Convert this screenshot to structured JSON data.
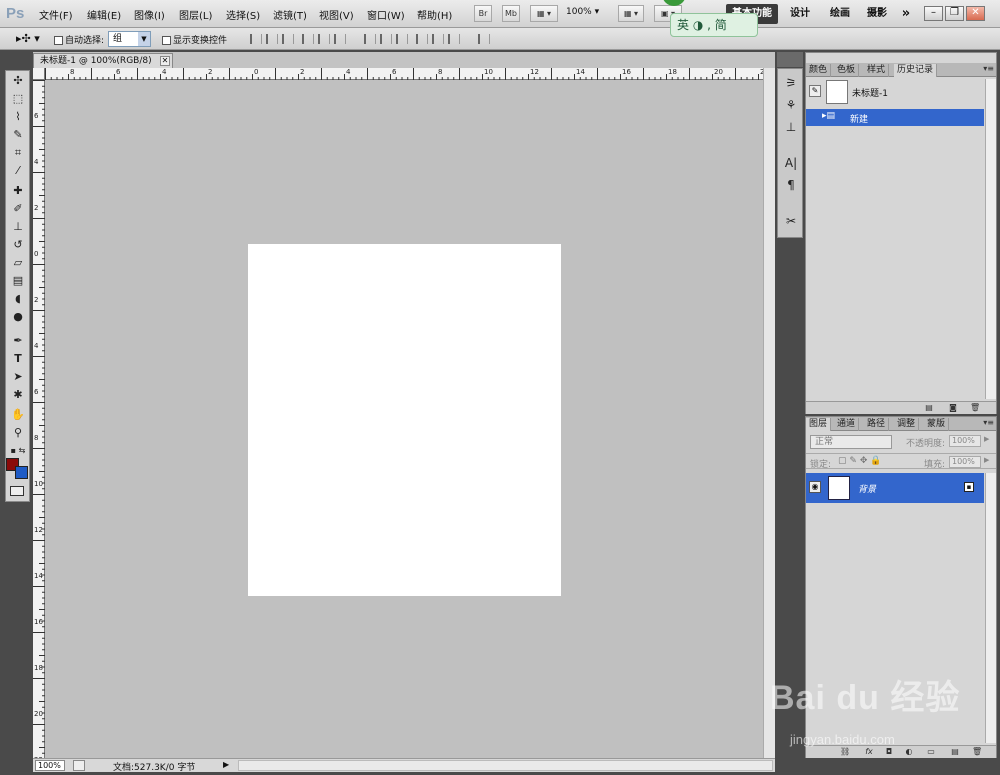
{
  "app": {
    "logo": "Ps"
  },
  "menubar": {
    "items": [
      "文件(F)",
      "编辑(E)",
      "图像(I)",
      "图层(L)",
      "选择(S)",
      "滤镜(T)",
      "视图(V)",
      "窗口(W)",
      "帮助(H)"
    ],
    "br_label": "Br",
    "mb_label": "Mb",
    "zoom_value": "100%",
    "workspaces": [
      "基本功能",
      "设计",
      "绘画",
      "摄影"
    ],
    "more": "»",
    "window_controls": [
      "–",
      "❐",
      "✕"
    ]
  },
  "ime": {
    "text": "英 ◑ , 简"
  },
  "options_bar": {
    "auto_select_label": "自动选择:",
    "auto_select_value": "组",
    "show_transform_label": "显示变换控件"
  },
  "document": {
    "tab_title": "未标题-1 @ 100%(RGB/8)",
    "tab_close": "✕",
    "ruler_h_labels": [
      "8",
      "6",
      "4",
      "2",
      "0",
      "2",
      "4",
      "6",
      "8",
      "10",
      "12",
      "14",
      "16",
      "18",
      "20",
      "22"
    ],
    "ruler_v_labels": [
      "6",
      "4",
      "2",
      "0",
      "2",
      "4",
      "6",
      "8",
      "10",
      "12",
      "14",
      "16",
      "18",
      "20",
      "22"
    ],
    "status_zoom": "100%",
    "status_doc": "文档:527.3K/0 字节"
  },
  "history_panel": {
    "tabs": [
      "颜色",
      "色板",
      "样式",
      "历史记录"
    ],
    "snapshot_name": "未标题-1",
    "history_item": "新建"
  },
  "layers_panel": {
    "tabs": [
      "图层",
      "通道",
      "路径",
      "调整",
      "蒙版"
    ],
    "blend_mode": "正常",
    "opacity_label": "不透明度:",
    "opacity_value": "100%",
    "lock_label": "锁定:",
    "fill_label": "填充:",
    "fill_value": "100%",
    "layer_name": "背景"
  },
  "colors": {
    "foreground": "#8a0a0a",
    "background": "#1e5bc6",
    "selection": "#3366cc",
    "canvas_bg": "#c0c0c0"
  },
  "watermark": {
    "main": "Bai du 经验",
    "sub": "jingyan.baidu.com"
  }
}
